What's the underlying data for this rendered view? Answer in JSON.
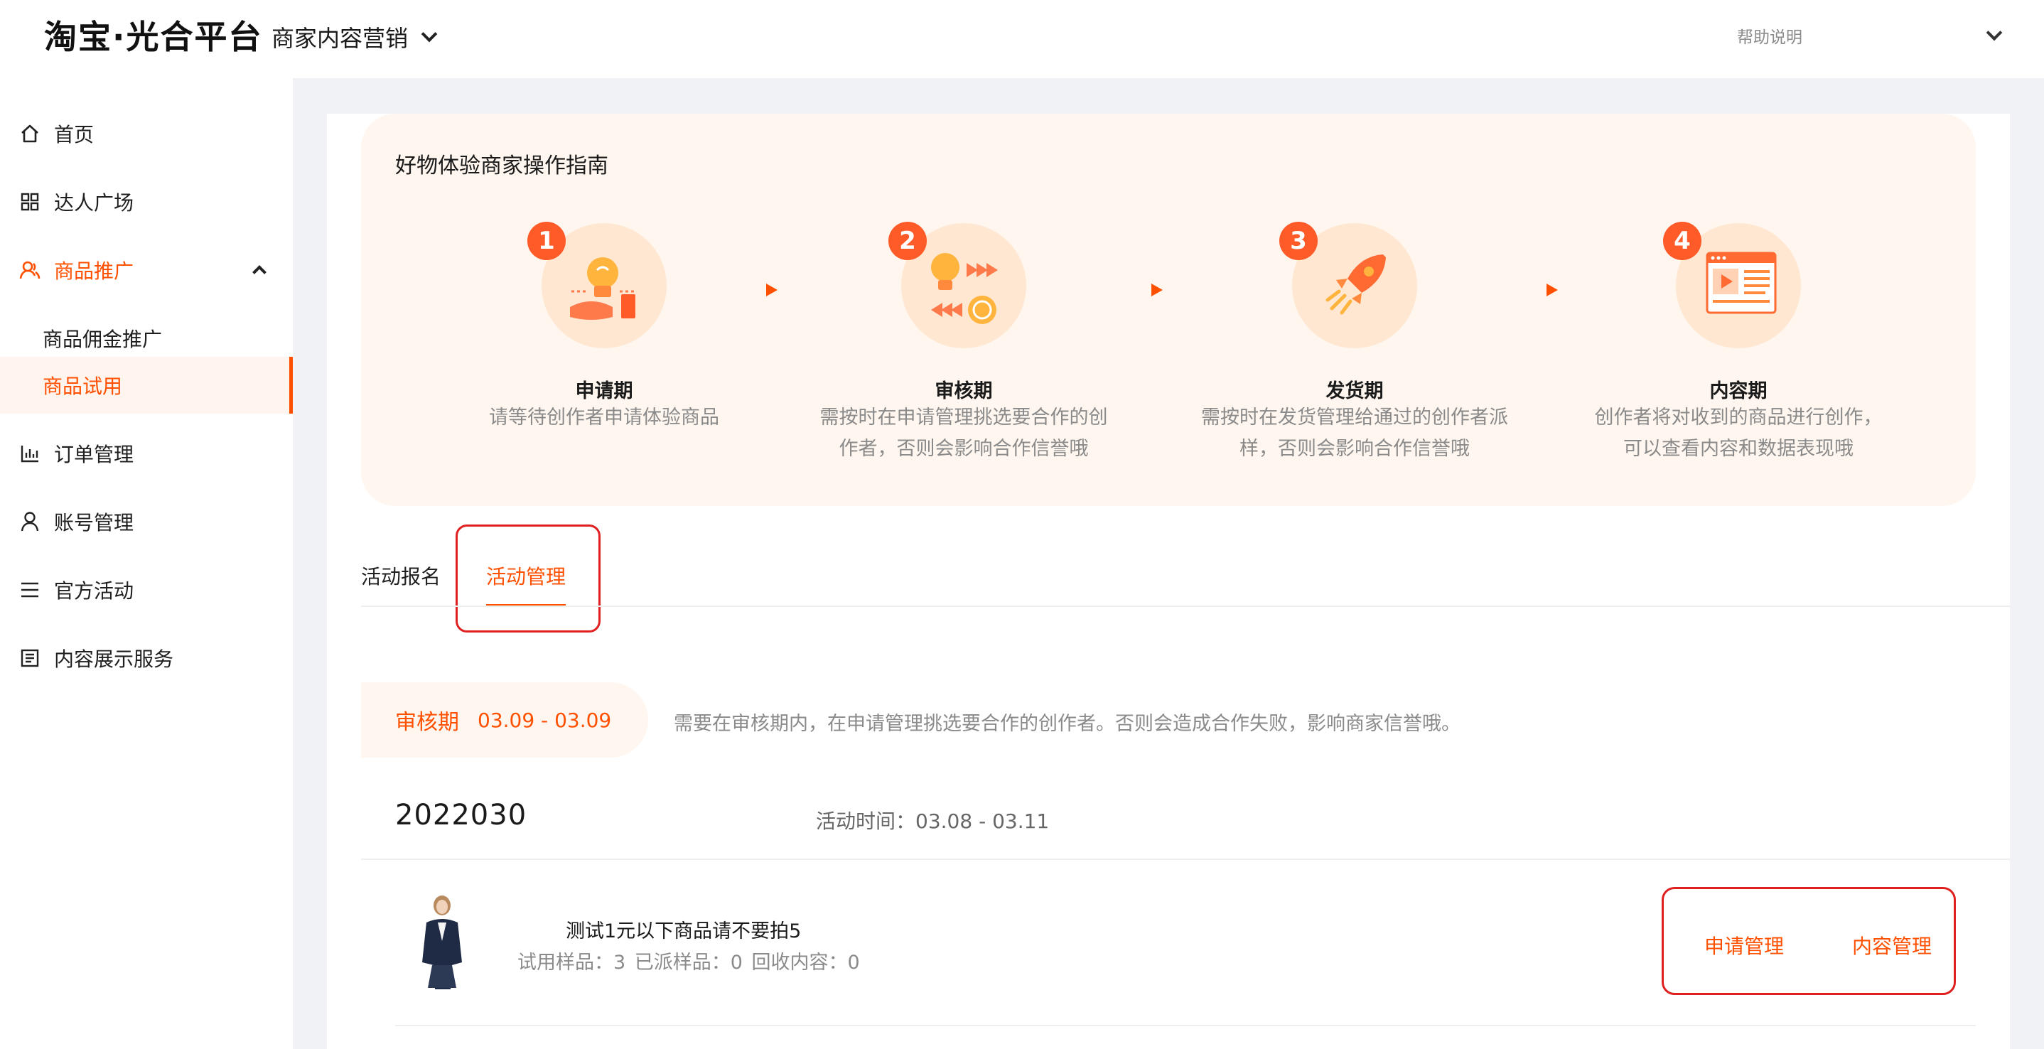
{
  "header": {
    "logo": "淘宝·光合平台",
    "product": "商家内容营销",
    "help": "帮助说明"
  },
  "sidebar": {
    "items": [
      {
        "label": "首页",
        "icon": "home-icon"
      },
      {
        "label": "达人广场",
        "icon": "grid-icon"
      },
      {
        "label": "商品推广",
        "icon": "people-icon",
        "expanded": true
      },
      {
        "label": "商品佣金推广",
        "sub": true
      },
      {
        "label": "商品试用",
        "sub": true,
        "active": true
      },
      {
        "label": "订单管理",
        "icon": "chart-icon"
      },
      {
        "label": "账号管理",
        "icon": "user-icon"
      },
      {
        "label": "官方活动",
        "icon": "list-icon"
      },
      {
        "label": "内容展示服务",
        "icon": "document-icon"
      }
    ]
  },
  "guide": {
    "title": "好物体验商家操作指南",
    "steps": [
      {
        "num": "1",
        "title": "申请期",
        "desc_lines": [
          "请等待创作者申请体验商品"
        ]
      },
      {
        "num": "2",
        "title": "审核期",
        "desc_lines": [
          "需按时在申请管理挑选要合作的创",
          "作者，否则会影响合作信誉哦"
        ]
      },
      {
        "num": "3",
        "title": "发货期",
        "desc_lines": [
          "需按时在发货管理给通过的创作者派",
          "样，否则会影响合作信誉哦"
        ]
      },
      {
        "num": "4",
        "title": "内容期",
        "desc_lines": [
          "创作者将对收到的商品进行创作，",
          "可以查看内容和数据表现哦"
        ]
      }
    ]
  },
  "tabs": [
    {
      "label": "活动报名",
      "active": false
    },
    {
      "label": "活动管理",
      "active": true
    }
  ],
  "period": {
    "name": "审核期",
    "range": "03.09 - 03.09",
    "note": "需要在审核期内，在申请管理挑选要合作的创作者。否则会造成合作失败，影响商家信誉哦。"
  },
  "activity": {
    "name": "2022030",
    "time_label": "活动时间：",
    "time_range": "03.08 - 03.11"
  },
  "product": {
    "title": "测试1元以下商品请不要拍5",
    "stats": "试用样品：3   已派样品：0   回收内容：0",
    "actions": [
      "申请管理",
      "内容管理"
    ]
  },
  "colors": {
    "accent": "#ff5000",
    "highlight_border": "#e02020",
    "guide_bg": "#fff6ef"
  }
}
